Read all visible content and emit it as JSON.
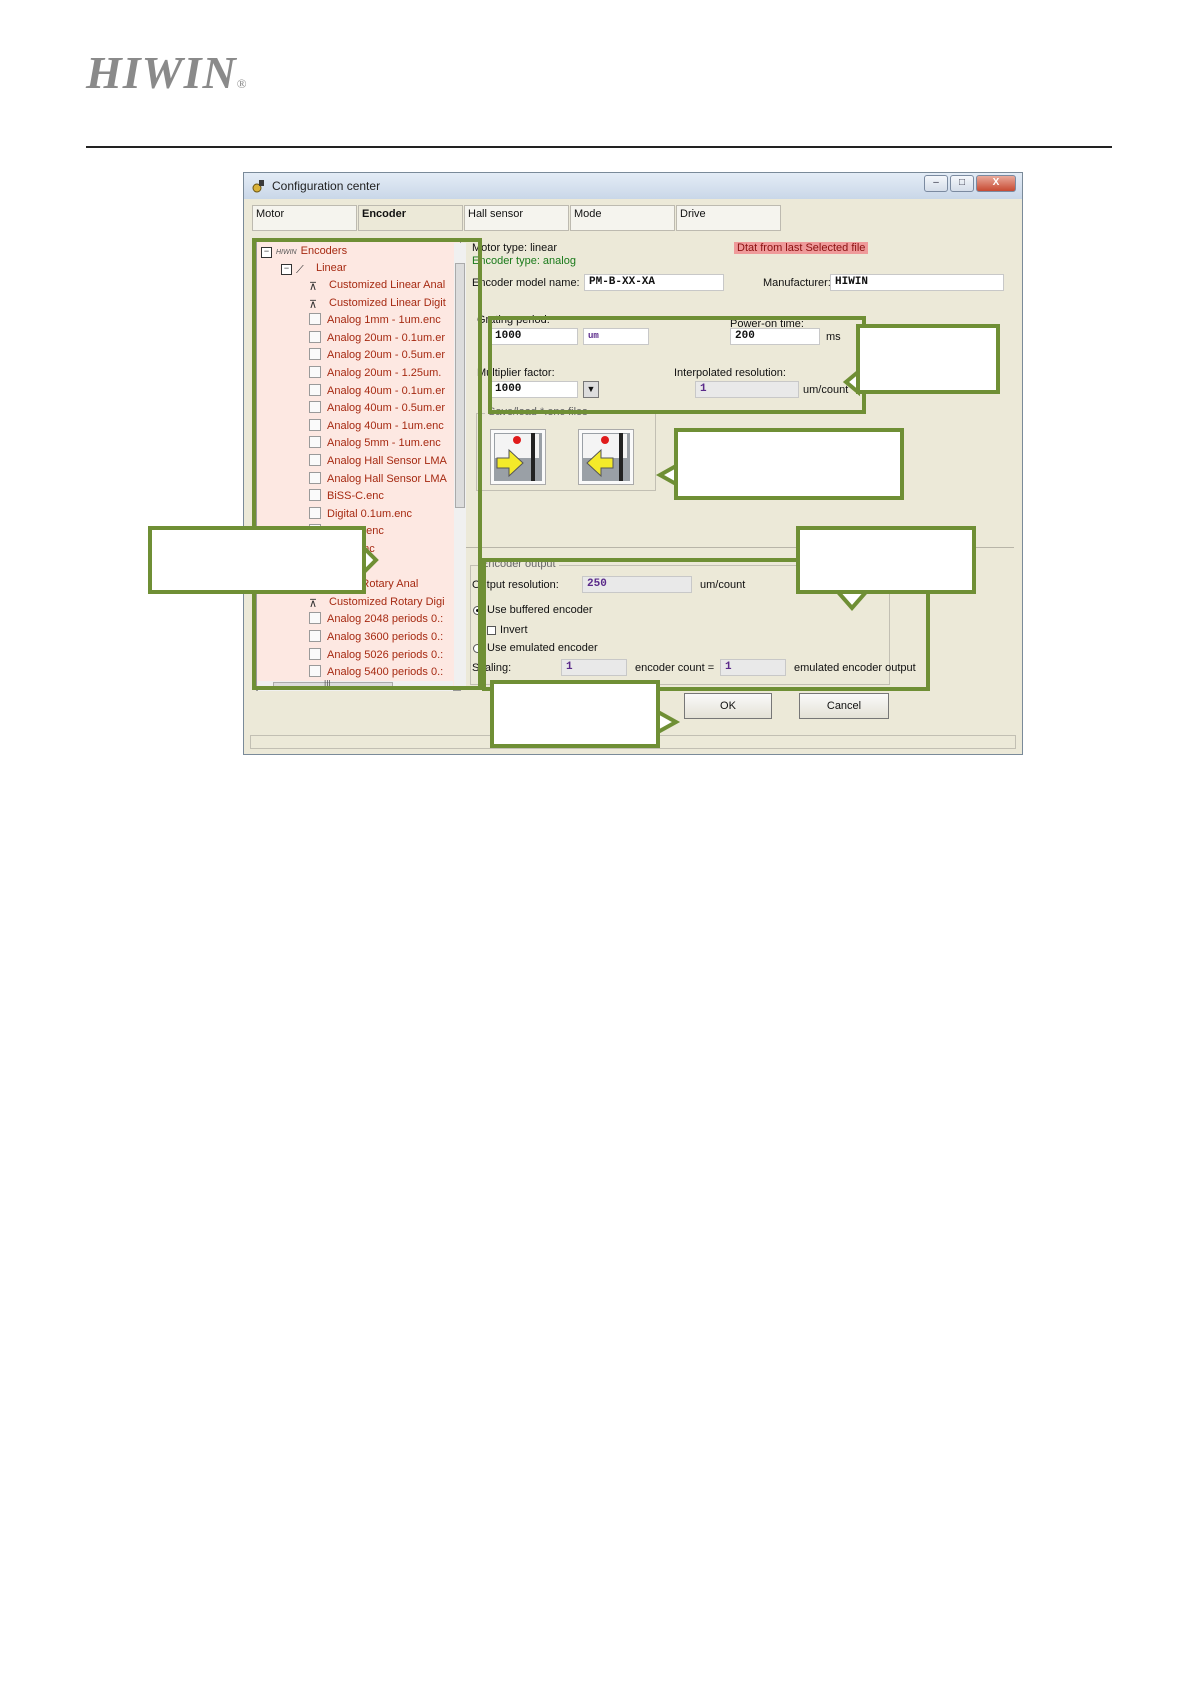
{
  "header": {
    "logo_text": "HIWIN",
    "logo_mark": "®"
  },
  "window": {
    "title": "Configuration center",
    "controls": [
      "–",
      "□",
      "X"
    ]
  },
  "tabs": [
    {
      "label": "Motor"
    },
    {
      "label": "Encoder"
    },
    {
      "label": "Hall sensor"
    },
    {
      "label": "Mode"
    },
    {
      "label": "Drive"
    }
  ],
  "tree": {
    "root": "Encoders",
    "root_logo": "HIWIN",
    "group": "Linear",
    "items": [
      {
        "label": "Customized Linear Anal",
        "icon": "switch-icon"
      },
      {
        "label": "Customized Linear Digit",
        "icon": "switch-icon"
      },
      {
        "label": "Analog 1mm - 1um.enc",
        "icon": "file-icon"
      },
      {
        "label": "Analog 20um - 0.1um.er",
        "icon": "file-icon"
      },
      {
        "label": "Analog 20um - 0.5um.er",
        "icon": "file-icon"
      },
      {
        "label": "Analog 20um - 1.25um.",
        "icon": "file-icon"
      },
      {
        "label": "Analog 40um - 0.1um.er",
        "icon": "file-icon"
      },
      {
        "label": "Analog 40um - 0.5um.er",
        "icon": "file-icon"
      },
      {
        "label": "Analog 40um - 1um.enc",
        "icon": "file-icon"
      },
      {
        "label": "Analog 5mm - 1um.enc",
        "icon": "file-icon"
      },
      {
        "label": "Analog Hall Sensor LMA",
        "icon": "file-icon"
      },
      {
        "label": "Analog Hall Sensor LMA",
        "icon": "file-icon"
      },
      {
        "label": "BiSS-C.enc",
        "icon": "file-icon"
      },
      {
        "label": "Digital 0.1um.enc",
        "icon": "file-icon"
      },
      {
        "label": "l 0.5um.enc",
        "icon": "file-icon"
      },
      {
        "label": "l 1um.enc",
        "icon": "file-icon"
      },
      {
        "label": "",
        "icon": "file-icon"
      },
      {
        "label": "mized Rotary Anal",
        "icon": "switch-icon"
      },
      {
        "label": "Customized Rotary Digi",
        "icon": "switch-icon"
      },
      {
        "label": "Analog 2048 periods 0.:",
        "icon": "file-icon"
      },
      {
        "label": "Analog 3600 periods 0.:",
        "icon": "file-icon"
      },
      {
        "label": "Analog 5026 periods 0.:",
        "icon": "file-icon"
      },
      {
        "label": "Analog 5400 periods 0.:",
        "icon": "file-icon"
      }
    ],
    "hscroll_marker": "III"
  },
  "info": {
    "motor_type": "Motor type: linear",
    "encoder_type": "Encoder type: analog",
    "data_source": "Dtat from last Selected file",
    "model_name_label": "Encoder model name:",
    "model_name_value": "PM-B-XX-XA",
    "manufacturer_label": "Manufacturer:",
    "manufacturer_value": "HIWIN"
  },
  "grating": {
    "grating_label": "Grating period:",
    "grating_value": "1000",
    "grating_unit": "um",
    "power_on_label": "Power-on time:",
    "power_on_value": "200",
    "power_on_unit": "ms",
    "multiplier_label": "Multiplier factor:",
    "multiplier_value": "1000",
    "interp_label": "Interpolated resolution:",
    "interp_value": "1",
    "interp_unit": "um/count"
  },
  "saveload": {
    "title": "Save/load *.enc files"
  },
  "output": {
    "title": "Encoder output",
    "resolution_label": "Output resolution:",
    "resolution_value": "250",
    "resolution_unit": "um/count",
    "buffered_label": "Use buffered encoder",
    "invert_label": "Invert",
    "emulated_label": "Use emulated encoder",
    "scaling_label": "Scaling:",
    "scaling_value": "1",
    "count_label": "encoder count =",
    "count_value": "1",
    "emulated_output_label": "emulated encoder output"
  },
  "buttons": {
    "ok": "OK",
    "cancel": "Cancel"
  },
  "colors": {
    "annotation": "#6f8f35",
    "tree_bg": "#fde8e2",
    "tree_text": "#a62a12",
    "badge": "#ef9a9a"
  }
}
